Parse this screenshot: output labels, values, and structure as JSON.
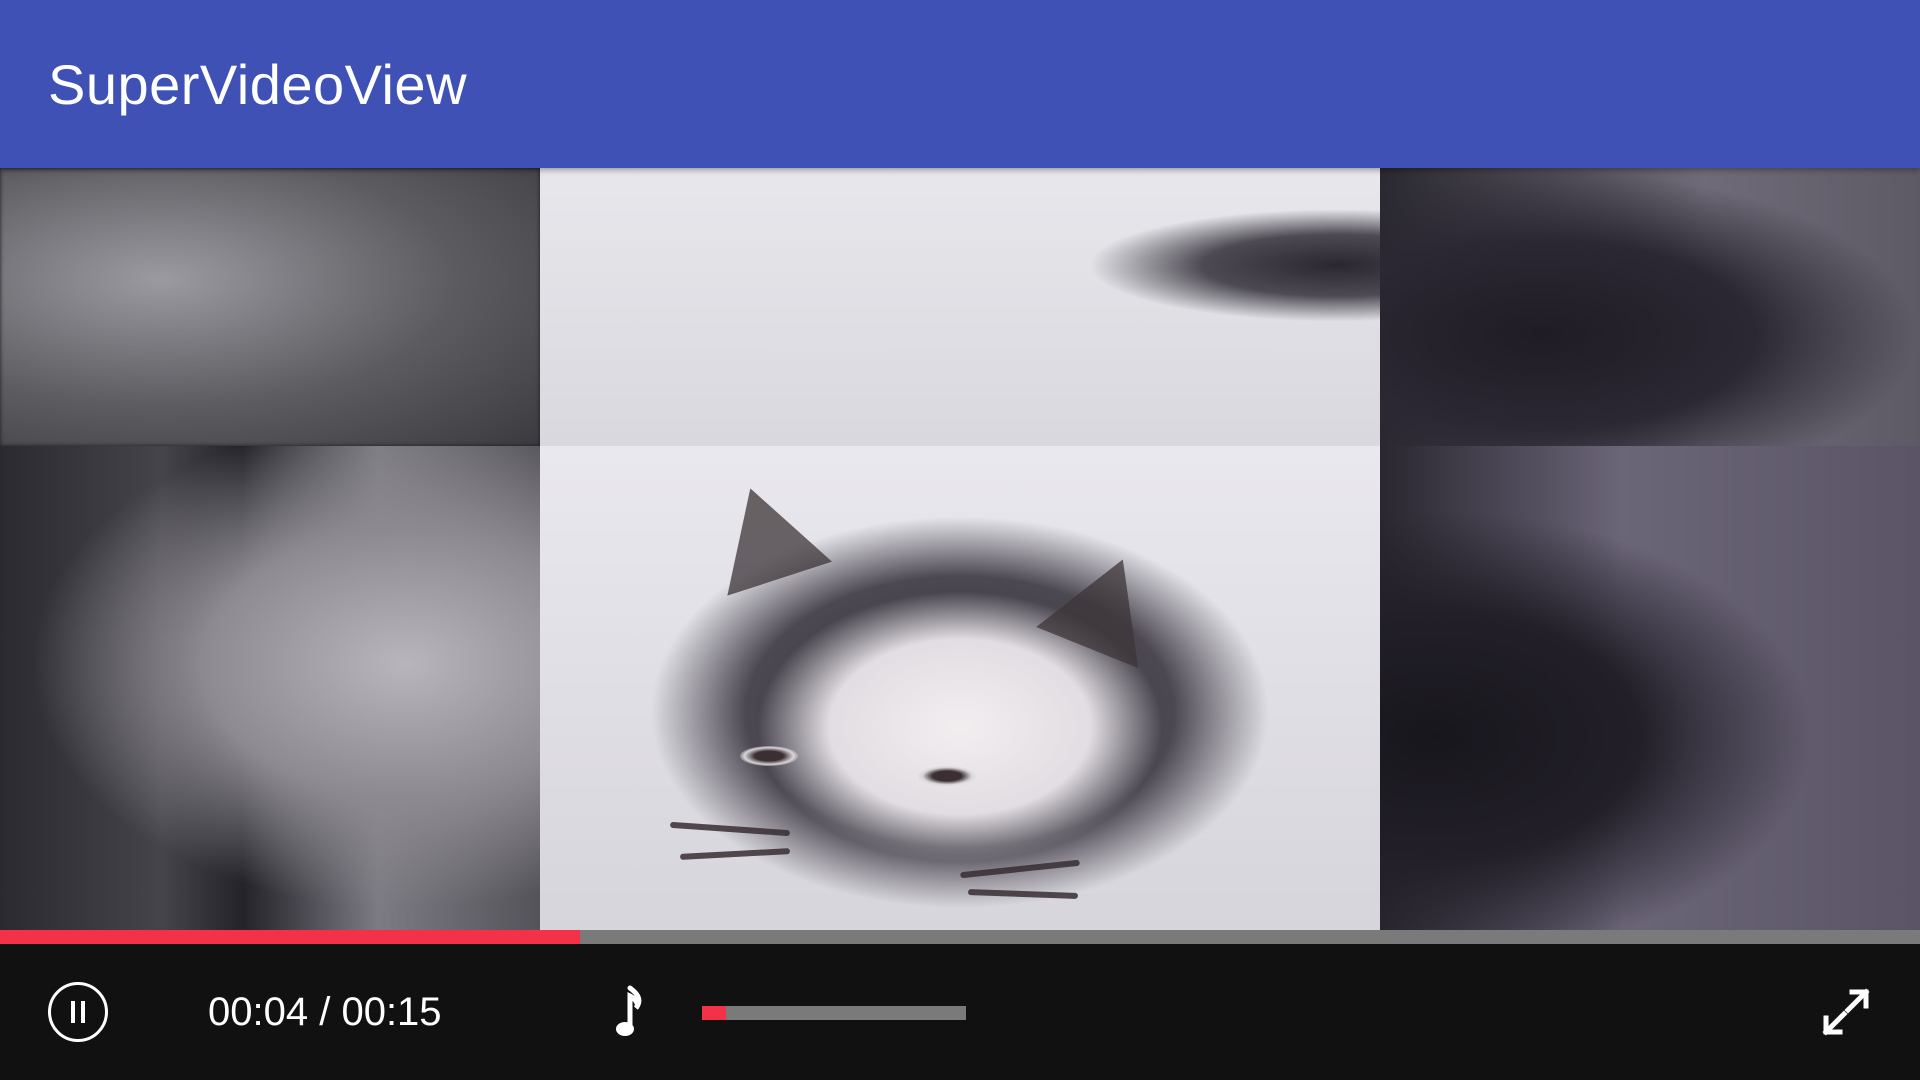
{
  "app": {
    "title": "SuperVideoView"
  },
  "player": {
    "current_time": "00:04",
    "separator": " / ",
    "duration": "00:15",
    "progress_fraction": 0.302,
    "volume_fraction": 0.09,
    "is_playing": true
  },
  "icons": {
    "play_pause": "pause-icon",
    "audio": "music-note-icon",
    "fullscreen": "fullscreen-expand-icon"
  },
  "colors": {
    "appbar": "#3f51b5",
    "accent": "#f33148",
    "track": "#7a7a7a",
    "controls_bg": "#111111"
  }
}
